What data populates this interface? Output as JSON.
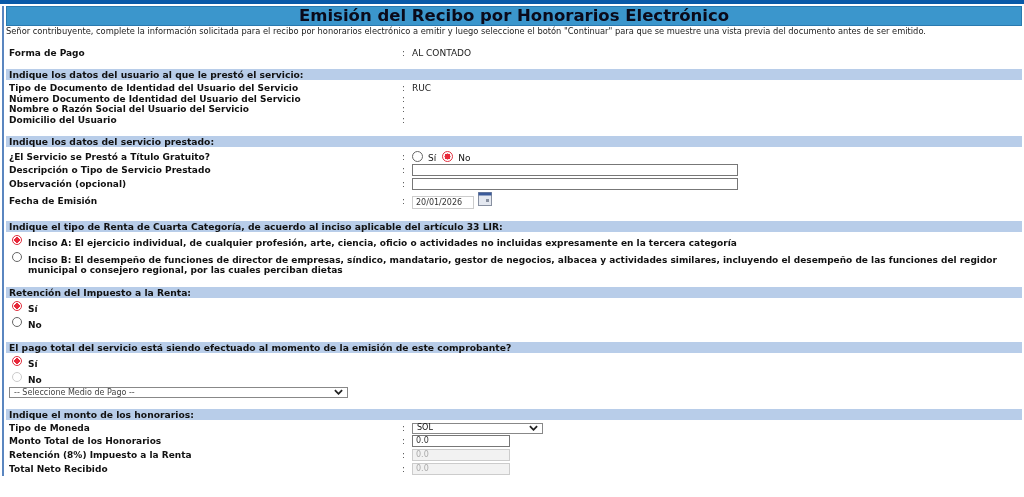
{
  "title": "Emisión del Recibo por Honorarios Electrónico",
  "intro": "Señor contribuyente, complete la información solicitada para el recibo por honorarios electrónico a emitir y luego seleccione el botón \"Continuar\" para que se muestre una vista previa del documento antes de ser emitido.",
  "sections": [
    {
      "rows": [
        {
          "kind": "text",
          "label": "Forma de Pago",
          "separator": ":",
          "value": "AL CONTADO"
        }
      ]
    },
    {
      "heading": "Indique los datos del usuario al que le prestó el servicio:",
      "rows": [
        {
          "kind": "text",
          "label": "Tipo de Documento de Identidad del Usuario del Servicio",
          "separator": ":",
          "value": "RUC"
        },
        {
          "kind": "text",
          "label": "Número Documento de Identidad del Usuario del Servicio",
          "separator": ":"
        },
        {
          "kind": "text",
          "label": "Nombre o Razón Social del Usuario del Servicio",
          "separator": ":"
        },
        {
          "kind": "text",
          "label": "Domicilio del Usuario",
          "separator": ":"
        }
      ]
    },
    {
      "heading": "Indique los datos del servicio prestado:",
      "rows": [
        {
          "kind": "radios",
          "label": "¿El Servicio se Prestó a Título Gratuito?",
          "separator": ":",
          "options": [
            {
              "label": "Sí",
              "selected": false
            },
            {
              "label": "No",
              "selected": true
            }
          ]
        },
        {
          "kind": "wide_input",
          "label": "Descripción o Tipo de Servicio Prestado",
          "separator": ":"
        },
        {
          "kind": "wide_input",
          "label": "Observación (opcional)",
          "separator": ":"
        },
        {
          "kind": "date_input",
          "label": "Fecha de Emisión",
          "separator": ":",
          "value": "20/01/2026"
        }
      ]
    },
    {
      "heading": "Indique el tipo de Renta de Cuarta Categoría, de acuerdo al inciso aplicable del artículo 33 LIR:",
      "rows": [
        {
          "kind": "choices",
          "options": [
            {
              "label": "Inciso A: El ejercicio individual, de cualquier profesión, arte, ciencia, oficio o actividades no incluidas expresamente en la tercera categoría",
              "selected": true
            },
            {
              "label": "Inciso B: El desempeño de funciones de director de empresas, síndico, mandatario, gestor de negocios, albacea y actividades similares, incluyendo el desempeño de las funciones del regidor municipal o consejero regional, por las cuales perciban dietas",
              "selected": false
            }
          ]
        }
      ]
    },
    {
      "heading": "Retención del Impuesto a la Renta:",
      "rows": [
        {
          "kind": "choices",
          "options": [
            {
              "label": "Sí",
              "selected": true
            },
            {
              "label": "No",
              "selected": false
            }
          ]
        }
      ]
    },
    {
      "heading": "El pago total del servicio está siendo efectuado al momento de la emisión de este comprobante?",
      "rows": [
        {
          "kind": "choices",
          "options": [
            {
              "label": "Sí",
              "selected": true,
              "disabled": false
            },
            {
              "label": "No",
              "selected": false,
              "disabled": true
            }
          ]
        },
        {
          "kind": "wide_select",
          "value": "-- Seleccione Medio de Pago --"
        }
      ]
    },
    {
      "heading": "Indique el monto de los honorarios:",
      "rows": [
        {
          "kind": "select",
          "label": "Tipo de Moneda",
          "separator": ":",
          "value": "SOL"
        },
        {
          "kind": "amount_input",
          "label": "Monto Total de los Honorarios",
          "separator": ":",
          "value": "0.0",
          "disabled": false
        },
        {
          "kind": "amount_input",
          "label": "Retención (8%) Impuesto a la Renta",
          "separator": ":",
          "value": "0.0",
          "disabled": true
        },
        {
          "kind": "amount_input",
          "label": "Total Neto Recibido",
          "separator": ":",
          "value": "0.0",
          "disabled": true
        }
      ]
    }
  ]
}
